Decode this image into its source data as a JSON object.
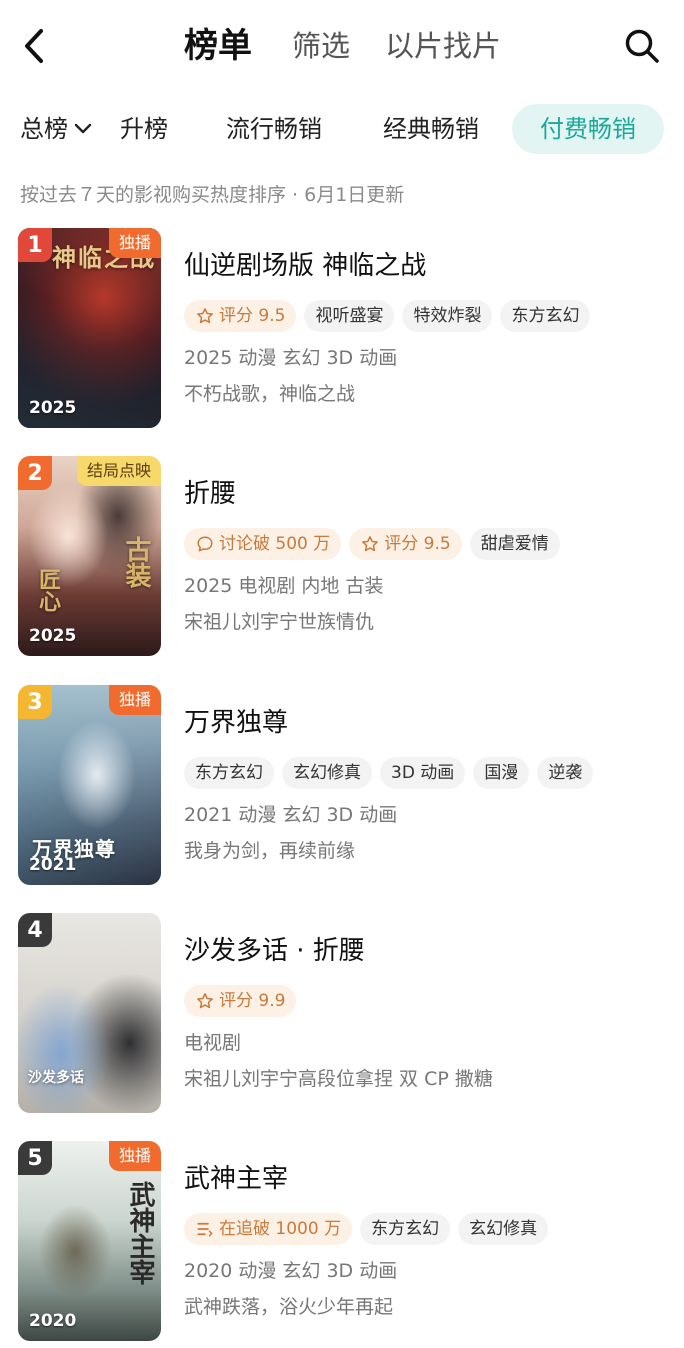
{
  "topbar": {
    "tabs": [
      "榜单",
      "筛选",
      "以片找片"
    ]
  },
  "categories": [
    "总榜",
    "升榜",
    "流行畅销",
    "经典畅销",
    "付费畅销"
  ],
  "subtitle": "按过去７天的影视购买热度排序 · 6月1日更新",
  "items": [
    {
      "rank": "1",
      "corner": "独播",
      "year": "2025",
      "title": "仙逆剧场版 神临之战",
      "tags": [
        {
          "text": "评分 9.5",
          "hot": true,
          "icon": "star-icon"
        },
        {
          "text": "视听盛宴",
          "hot": false
        },
        {
          "text": "特效炸裂",
          "hot": false
        },
        {
          "text": "东方玄幻",
          "hot": false
        }
      ],
      "meta": "2025 动漫 玄幻 3D 动画",
      "desc": "不朽战歌，神临之战"
    },
    {
      "rank": "2",
      "corner": "结局点映",
      "year": "2025",
      "title": "折腰",
      "tags": [
        {
          "text": "讨论破 500 万",
          "hot": true,
          "icon": "chat-bubble-icon"
        },
        {
          "text": "评分 9.5",
          "hot": true,
          "icon": "star-icon"
        },
        {
          "text": "甜虐爱情",
          "hot": false
        }
      ],
      "meta": "2025 电视剧 内地 古装",
      "desc": "宋祖儿刘宇宁世族情仇"
    },
    {
      "rank": "3",
      "corner": "独播",
      "year": "2021",
      "title": "万界独尊",
      "tags": [
        {
          "text": "东方玄幻",
          "hot": false
        },
        {
          "text": "玄幻修真",
          "hot": false
        },
        {
          "text": "3D 动画",
          "hot": false
        },
        {
          "text": "国漫",
          "hot": false
        },
        {
          "text": "逆袭",
          "hot": false
        }
      ],
      "meta": "2021 动漫 玄幻 3D 动画",
      "desc": "我身为剑，再续前缘"
    },
    {
      "rank": "4",
      "corner": "",
      "year": "",
      "title": "沙发多话 · 折腰",
      "tags": [
        {
          "text": "评分 9.9",
          "hot": true,
          "icon": "star-icon"
        }
      ],
      "meta": "电视剧",
      "desc": "宋祖儿刘宇宁高段位拿捏 双 CP 撒糖"
    },
    {
      "rank": "5",
      "corner": "独播",
      "year": "2020",
      "title": "武神主宰",
      "tags": [
        {
          "text": "在追破 1000 万",
          "hot": true,
          "icon": "list-icon"
        },
        {
          "text": "东方玄幻",
          "hot": false
        },
        {
          "text": "玄幻修真",
          "hot": false
        }
      ],
      "meta": "2020 动漫 玄幻 3D 动画",
      "desc": "武神跌落，浴火少年再起"
    }
  ],
  "colors": {
    "accent": "#1aa99b",
    "accent_bg": "#e3f5f3",
    "hot_tag_bg": "#fdf0e4",
    "hot_tag_text": "#c87a3c",
    "rank_1": "#e2483a",
    "rank_2": "#f26b2e",
    "rank_3": "#f5b731",
    "rank_other": "#3a3a3a",
    "corner_exclusive": "#f26b2e",
    "corner_preview": "#f7d86a"
  },
  "poster_text": {
    "p1": "神临之战",
    "p2a": "古装",
    "p2b": "匠心",
    "p3": "万界独尊",
    "p4": "沙发多话",
    "p5": "武神主宰"
  }
}
